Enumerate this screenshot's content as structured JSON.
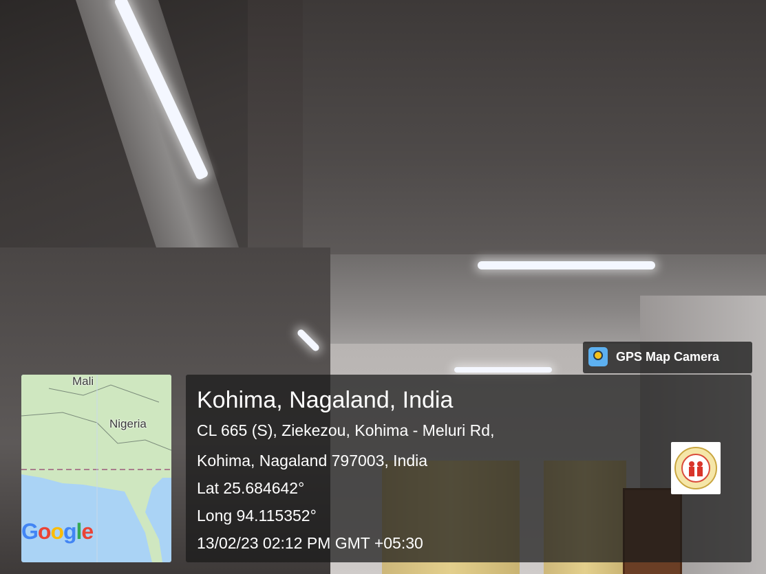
{
  "photo": {
    "location_title": "Kohima, Nagaland, India",
    "address_line1": "CL 665 (S), Ziekezou, Kohima - Meluri Rd,",
    "address_line2": "Kohima, Nagaland 797003, India",
    "latitude": "Lat 25.684642°",
    "longitude": "Long 94.115352°",
    "datetime": "13/02/23 02:12 PM GMT +05:30"
  },
  "map": {
    "labels": [
      "Mali",
      "Nigeria"
    ],
    "attribution_logo": "Google",
    "colors": {
      "water": "#aad3f5",
      "land": "#cfe7c0"
    }
  },
  "app_tag": {
    "name": "GPS Map Camera",
    "icon": "gps-map-camera-icon"
  },
  "badge": {
    "icon": "organization-logo-icon"
  }
}
